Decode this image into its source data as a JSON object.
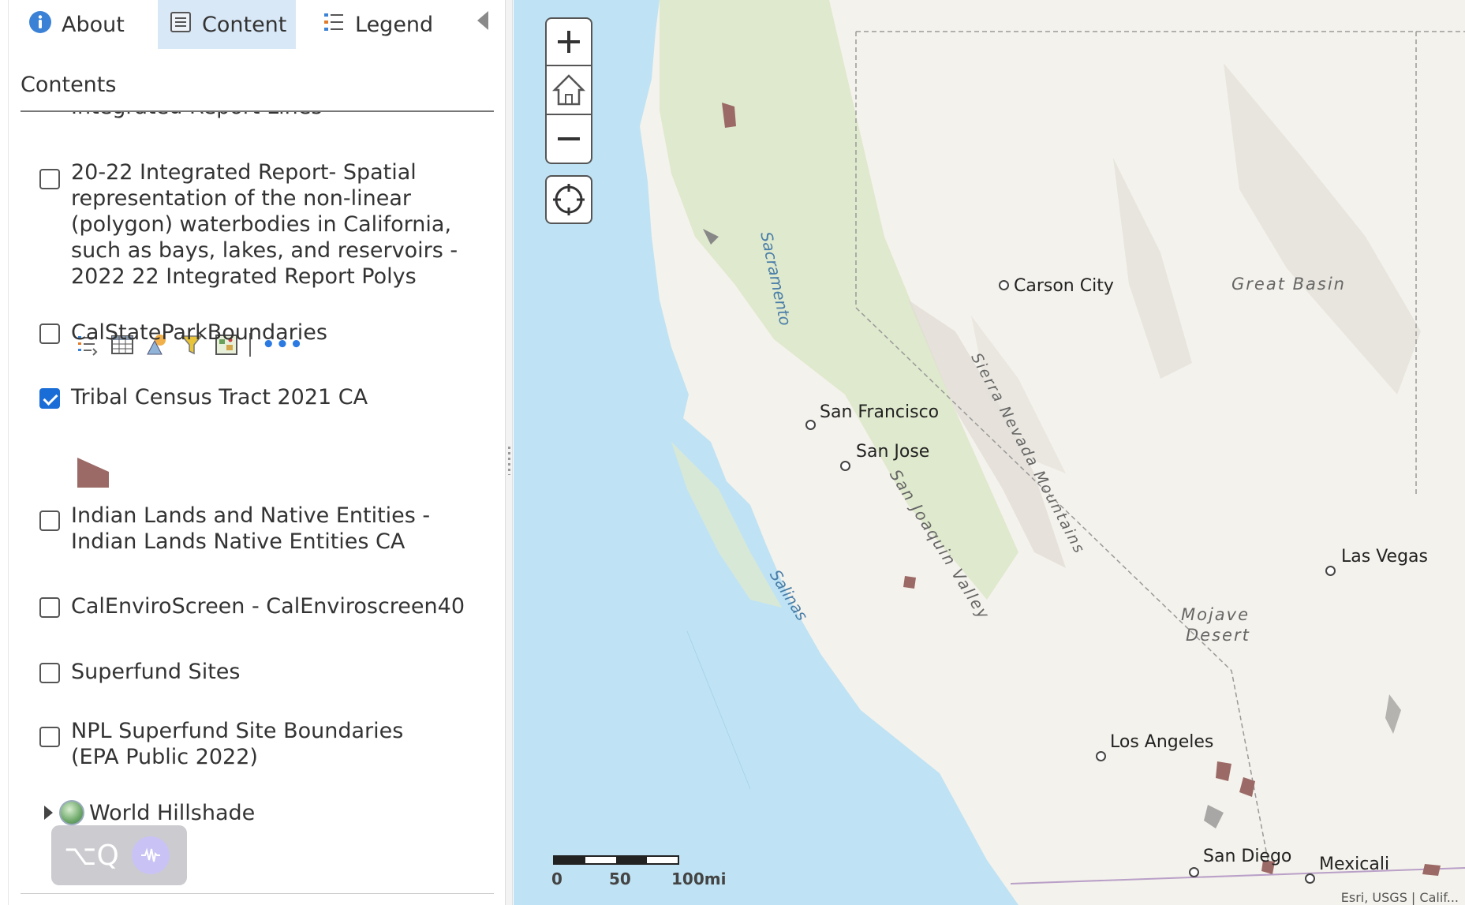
{
  "tabs": [
    {
      "label": "About",
      "icon": "info-icon",
      "active": false
    },
    {
      "label": "Content",
      "icon": "content-icon",
      "active": true
    },
    {
      "label": "Legend",
      "icon": "legend-icon",
      "active": false
    }
  ],
  "contents": {
    "title": "Contents",
    "clipped_item": "Integrated Report Lines",
    "layers": [
      {
        "label": "20-22 Integrated Report- Spatial representation of the non-linear (polygon) waterbodies in California, such as bays, lakes, and reservoirs - 2022 22 Integrated Report Polys",
        "checked": false
      },
      {
        "label": "CalStateParkBoundaries",
        "checked": false
      },
      {
        "label": "Tribal Census Tract 2021 CA",
        "checked": true
      },
      {
        "label": "Indian Lands and Native Entities - Indian Lands Native Entities CA",
        "checked": false
      },
      {
        "label": "CalEnviroScreen - CalEnviroscreen40",
        "checked": false
      },
      {
        "label": "Superfund Sites",
        "checked": false
      },
      {
        "label": "NPL Superfund Site Boundaries (EPA Public 2022)",
        "checked": false
      }
    ],
    "layer_tools": [
      "legend-list-icon",
      "table-icon",
      "shapes-icon",
      "filter-icon",
      "map-image-icon",
      "more-icon"
    ],
    "legend_swatch_color": "#9c6a66",
    "basemap_group": "World Hillshade"
  },
  "overlay": {
    "keys": "⌥Q"
  },
  "map": {
    "controls": [
      "zoom-in",
      "home",
      "zoom-out",
      "locate"
    ],
    "cities": [
      "Carson City",
      "San Francisco",
      "San Jose",
      "Las Vegas",
      "Los Angeles",
      "San Diego",
      "Mexicali"
    ],
    "regions": [
      "Great Basin",
      "Sierra Nevada Mountains",
      "San Joaquin Valley",
      "Mojave",
      "Desert"
    ],
    "water": [
      "Sacramento",
      "Salinas"
    ],
    "scale": {
      "labels": [
        "0",
        "50",
        "100mi"
      ]
    },
    "attribution": "Esri, USGS | Calif...",
    "colors": {
      "ocean": "#bfe3f4",
      "land": "#f4f2ec",
      "forest": "#d9e6c6",
      "tribal": "#9c6a66"
    }
  }
}
